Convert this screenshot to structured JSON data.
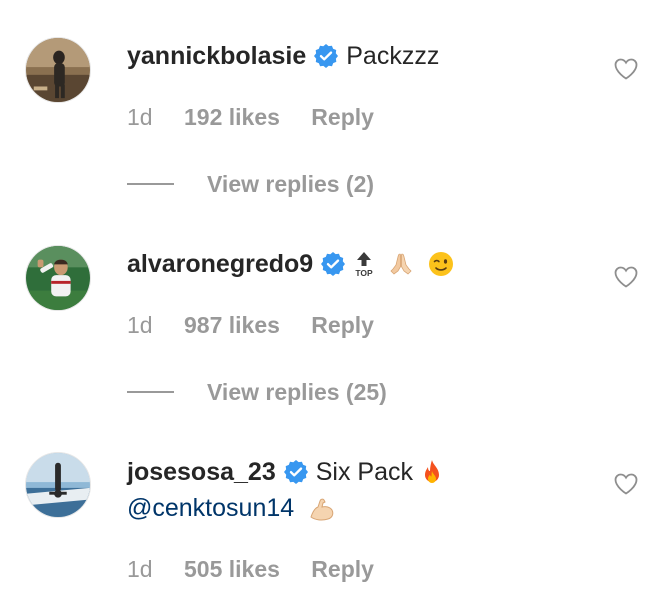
{
  "comments": [
    {
      "username": "yannickbolasie",
      "text": "Packzzz",
      "time": "1d",
      "likes": "192 likes",
      "reply": "Reply",
      "view_replies": "View replies (2)",
      "avatar_icon": "avatar-photo",
      "verified_icon": "verified-badge-icon"
    },
    {
      "username": "alvaronegredo9",
      "emoji_top_label": "TOP",
      "time": "1d",
      "likes": "987 likes",
      "reply": "Reply",
      "view_replies": "View replies (25)",
      "emojis": [
        "top-arrow-emoji",
        "folded-hands-emoji",
        "winking-face-emoji"
      ]
    },
    {
      "username": "josesosa_23",
      "text": "Six Pack",
      "mention": "@cenktosun14",
      "time": "1d",
      "likes": "505 likes",
      "reply": "Reply",
      "emojis": [
        "fire-emoji",
        "flexed-biceps-emoji"
      ]
    }
  ],
  "colors": {
    "username": "#262626",
    "meta": "#999999",
    "mention": "#003569",
    "verified": "#3897f0"
  }
}
